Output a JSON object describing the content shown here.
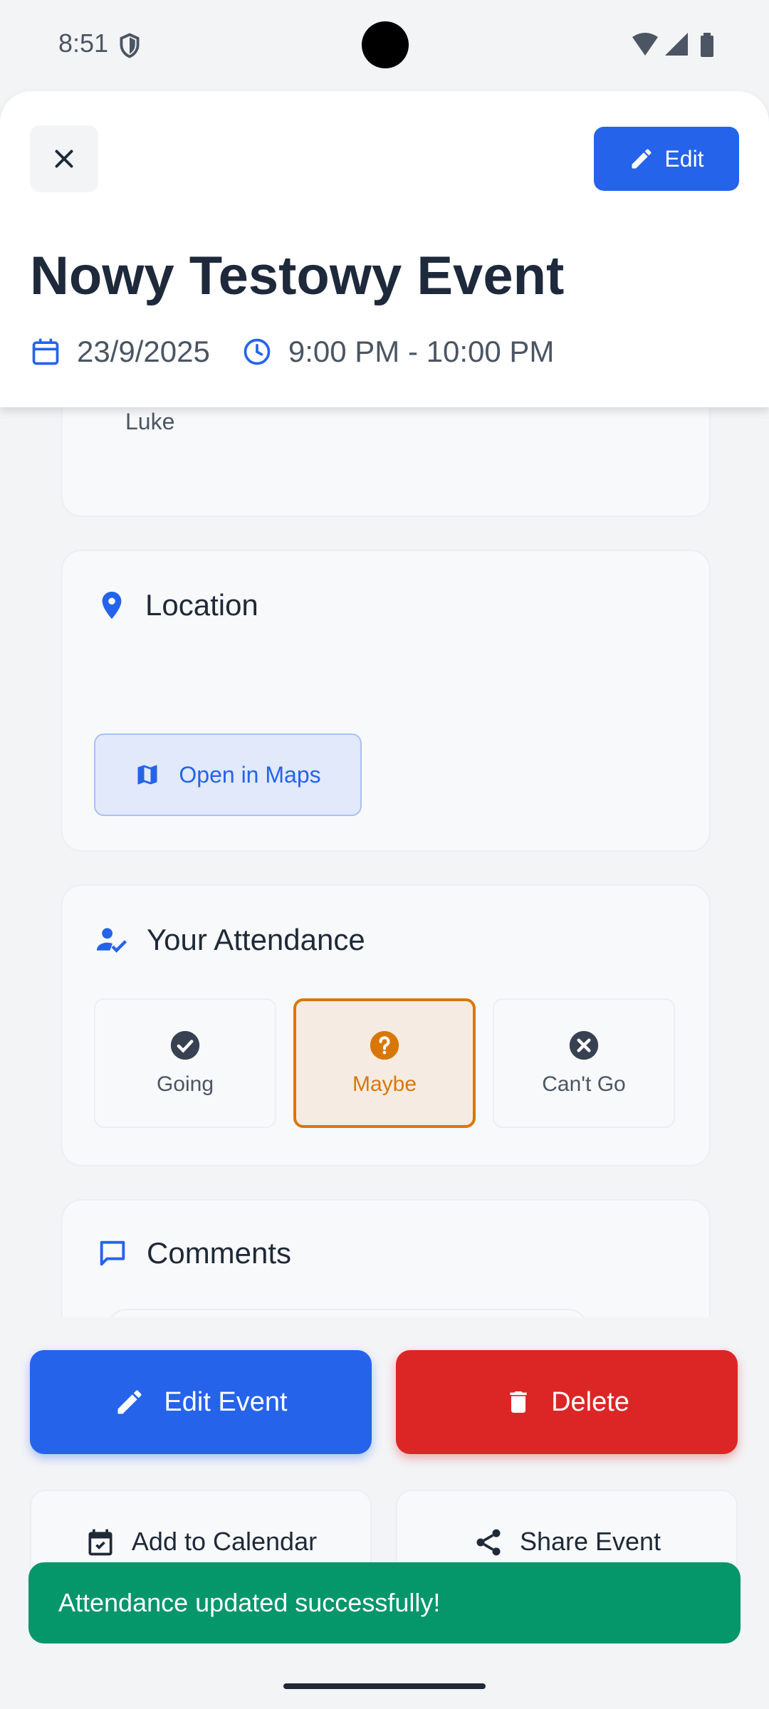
{
  "status_bar": {
    "time": "8:51"
  },
  "header": {
    "edit_label": "Edit",
    "title": "Nowy Testowy Event",
    "date": "23/9/2025",
    "time_range": "9:00 PM - 10:00 PM"
  },
  "organizer_card": {
    "name": "Luke"
  },
  "location_card": {
    "title": "Location",
    "open_maps_label": "Open in Maps"
  },
  "attendance_card": {
    "title": "Your Attendance",
    "options": [
      {
        "label": "Going",
        "selected": false
      },
      {
        "label": "Maybe",
        "selected": true
      },
      {
        "label": "Can't Go",
        "selected": false
      }
    ]
  },
  "comments_card": {
    "title": "Comments"
  },
  "actions": {
    "edit_event_label": "Edit Event",
    "delete_label": "Delete",
    "add_calendar_label": "Add to Calendar",
    "share_label": "Share Event"
  },
  "toast": {
    "message": "Attendance updated successfully!"
  },
  "colors": {
    "primary": "#2563eb",
    "danger": "#dc2626",
    "warning": "#d97706",
    "success": "#059669"
  },
  "icons": [
    "close-icon",
    "pencil-icon",
    "calendar-icon",
    "clock-icon",
    "map-pin-icon",
    "map-icon",
    "user-check-icon",
    "check-circle-icon",
    "help-circle-icon",
    "x-circle-icon",
    "chat-icon",
    "trash-icon",
    "share-icon"
  ]
}
